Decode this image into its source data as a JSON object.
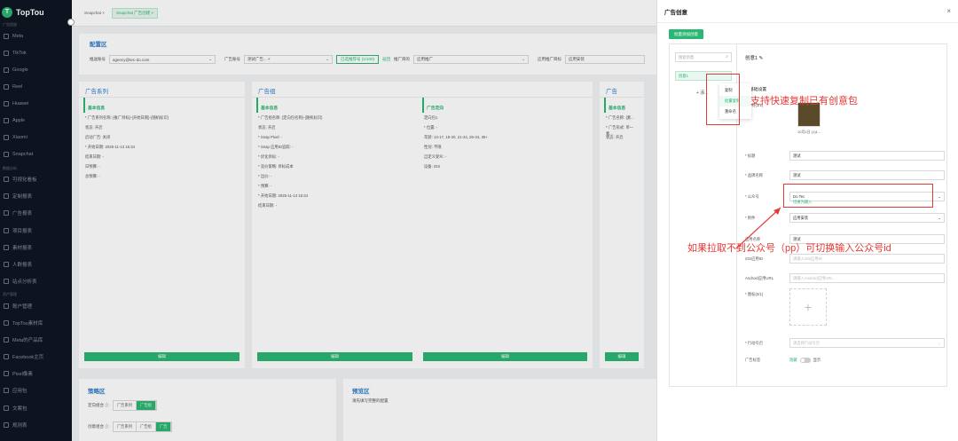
{
  "sidebar": {
    "brand": "TopTou",
    "brand_mark": "T",
    "groups": [
      "广告投放",
      "数据分析",
      "资产管理"
    ],
    "items_a": [
      "Meta",
      "TikTok",
      "Google",
      "Reel",
      "Huawei",
      "Apple",
      "Xiaomi",
      "Snapchat"
    ],
    "items_b": [
      "可视化看板",
      "定制报表",
      "广告报表",
      "项目报表",
      "素材报表",
      "人群报表",
      "站点分析表"
    ],
    "items_c": [
      "账户管理",
      "TopTou素材库",
      "Meta的产品库",
      "Facebook主页",
      "Pixel像素",
      "应用包",
      "文案包",
      "规则表"
    ]
  },
  "tabs": [
    "Snapchat ×",
    "Snapchat 广告创建 ×"
  ],
  "config": {
    "title": "配置区",
    "platform_label": "推送账号",
    "platform_value": "agency@tec-do.com",
    "ad_account_label": "广告账号",
    "ad_account_value": "测试广告... ×",
    "select_btn": "已选推荐号 (1/100)",
    "select_link": "返回",
    "promo_type_label": "推广目的",
    "promo_type_value": "应用推广",
    "app_label": "应用推广目标",
    "app_value": "应用安装"
  },
  "columns": [
    {
      "title": "广告系列",
      "sub": "基本信息",
      "rows": [
        "* 广告系列名称: {推广目标}-{开始日期}-{随机标识}",
        "状态: 开启",
        "启动广告: 关闭",
        "* 开始日期: 2025-11-13 15:34",
        "结束日期: -",
        "日预算: -",
        "总预算: -"
      ],
      "btn": "编辑"
    },
    {
      "title": "广告组",
      "sub": "基本信息",
      "rows": [
        "* 广告组名称: {定向包名称}-{随机标识}",
        "状态: 开启",
        "* Snap Pixel: -",
        "* Snap 应用ID追踪: -",
        "* 优化目标: -",
        "* 竞价策略: 目标成本",
        "* 出价: -",
        "* 预算: -",
        "* 开始日期: 2025-11-13 15:34",
        "结束日期: -"
      ],
      "btn": "编辑"
    },
    {
      "title": "",
      "sub": "广告定向",
      "rows": [
        "定向包1",
        "* 位置: -",
        "年龄: 13-17, 18-20, 21-24, 25-34, 35+",
        "性别: 不限",
        "自定义受众: -",
        "设备: iOS"
      ],
      "btn": "编辑"
    },
    {
      "title": "广告",
      "sub": "基本信息",
      "rows": [
        "* 广告名称: {素...",
        "* 广告形式: 单一素...",
        "状态: 开启"
      ],
      "btn": "编辑"
    }
  ],
  "strategy": {
    "title": "策略区",
    "row1_label": "定向组合 ⓘ",
    "row1_opts": [
      "广告系列",
      "广告组"
    ],
    "row2_label": "创意组合 ⓘ",
    "row2_opts": [
      "广告系列",
      "广告组",
      "广告"
    ]
  },
  "preview": {
    "title": "预览区",
    "desc": "请先填写完整的配置"
  },
  "drawer": {
    "title": "广告创意",
    "close": "×",
    "bulk_btn": "批量添加创意",
    "search_placeholder": "搜索创意",
    "creative_item": "创意1",
    "add_item": "+ 添...",
    "menu": [
      "复制",
      "批量复制",
      "重命名"
    ],
    "creative_name": "创意1 ✎",
    "basic": "基础设置",
    "material_label": "* 素材(1/1)",
    "material_caption": "10月1日 (1)1...",
    "fields": [
      {
        "label": "* 标题",
        "value": "测试",
        "ph": false
      },
      {
        "label": "* 品牌名称",
        "value": "测试",
        "ph": false
      },
      {
        "label": "* 公众号",
        "value": "Do Tec",
        "ph": false
      },
      {
        "label": "* 附件",
        "value": "应用安装",
        "ph": false
      },
      {
        "label": "应用名称",
        "value": "测试",
        "ph": false
      },
      {
        "label": "iOS应用ID",
        "value": "请输入iOS应用ID",
        "ph": true
      },
      {
        "label": "Android应用URL",
        "value": "请输入Android应用URL",
        "ph": true
      }
    ],
    "switch_link": "切换为输入",
    "icon_label": "* 图标(0/1)",
    "cta_label": "* 行动号召",
    "cta_ph": "请选择行动号召",
    "ad_label_label": "广告标签",
    "ad_label_off": "隐藏",
    "ad_label_on": "显示"
  },
  "annotations": {
    "copy_hint": "支持快速复制已有创意包",
    "account_hint": "如果拉取不到公众号（pp）可切换输入公众号id"
  },
  "colors": {
    "brand": "#2bb673",
    "annotation": "#e53935",
    "sidebar": "#0f1622",
    "link_blue": "#2e7dc9"
  }
}
